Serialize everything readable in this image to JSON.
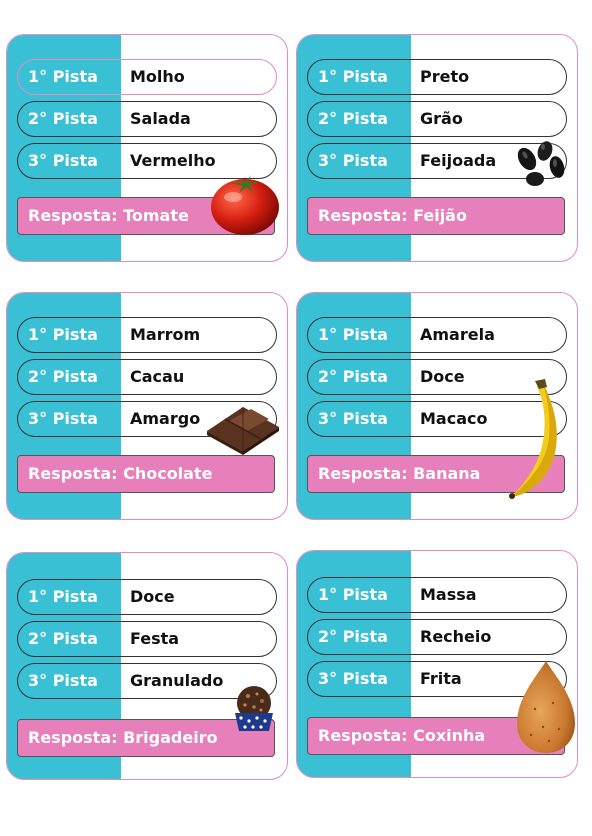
{
  "cards": [
    {
      "clues": [
        "Molho",
        "Salada",
        "Vermelho"
      ],
      "answer": "Resposta: Tomate",
      "icon": "tomato-icon"
    },
    {
      "clues": [
        "Preto",
        "Grão",
        "Feijoada"
      ],
      "answer": "Resposta:  Feijão",
      "icon": "black-beans-icon"
    },
    {
      "clues": [
        "Marrom",
        "Cacau",
        "Amargo"
      ],
      "answer": "Resposta: Chocolate",
      "icon": "chocolate-icon"
    },
    {
      "clues": [
        "Amarela",
        "Doce",
        "Macaco"
      ],
      "answer": "Resposta:  Banana",
      "icon": "banana-icon"
    },
    {
      "clues": [
        "Doce",
        "Festa",
        "Granulado"
      ],
      "answer": "Resposta: Brigadeiro",
      "icon": "brigadeiro-icon"
    },
    {
      "clues": [
        "Massa",
        "Recheio",
        "Frita"
      ],
      "answer": "Resposta:  Coxinha",
      "icon": "coxinha-icon"
    }
  ],
  "labels": {
    "pista1": "1° Pista",
    "pista2": "2° Pista",
    "pista3": "3° Pista"
  },
  "colors": {
    "stripe": "#39c0d4",
    "answer_bg": "#e67fba",
    "card_border": "#e58bbf"
  }
}
